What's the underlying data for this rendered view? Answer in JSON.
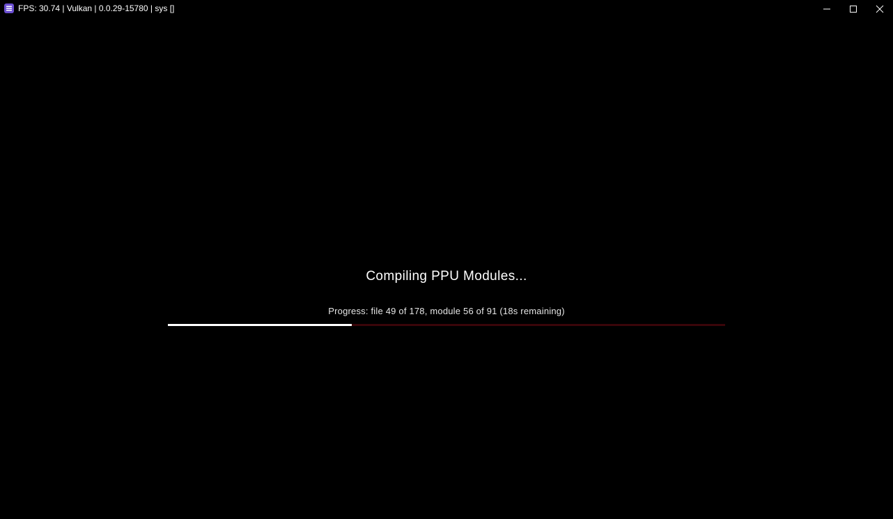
{
  "window": {
    "title": "FPS: 30.74 | Vulkan | 0.0.29-15780 | sys []",
    "app_icon": "rpcs3-icon",
    "controls": {
      "minimize_icon": "minimize-icon",
      "maximize_icon": "maximize-icon",
      "close_icon": "close-icon"
    }
  },
  "main": {
    "heading": "Compiling PPU Modules...",
    "progress_text": "Progress: file 49 of 178, module 56 of 91 (18s remaining)",
    "progress_fraction": 0.33
  },
  "colors": {
    "background": "#000000",
    "text": "#ffffff",
    "progress_fill": "#ffffff",
    "progress_track": "#3a0509",
    "app_icon": "#6b4fd1"
  }
}
